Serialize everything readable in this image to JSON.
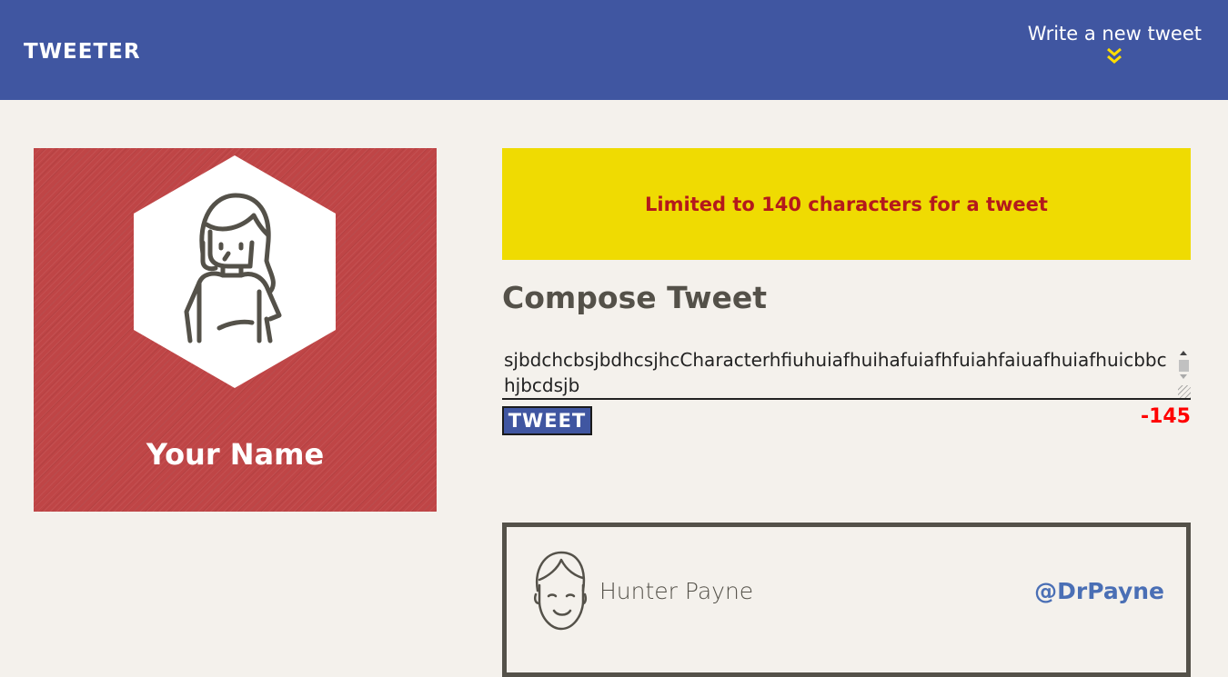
{
  "nav": {
    "brand": "TWEETER",
    "new_tweet_label": "Write a new tweet",
    "new_tweet_icon": "double-chevron-down-icon",
    "accent_color": "#4056a1",
    "chevron_color": "#ffdd00"
  },
  "profile": {
    "name": "Your Name",
    "avatar_icon": "woman-avatar-icon",
    "background_color": "#bf4546"
  },
  "error": {
    "message": "Limited to 140 characters for a tweet",
    "background_color": "#efdb02",
    "text_color": "#b4191c"
  },
  "compose": {
    "title": "Compose Tweet",
    "input_value": "sjbdchcbsjbdhcsjhcCharacterhfiuhuiafhuihafuiafhfuiahfaiuafhuiafhuicbbchjbcdsjb",
    "button_label": "TWEET",
    "counter": "-145"
  },
  "tweets": [
    {
      "author": "Hunter Payne",
      "handle": "@DrPayne",
      "avatar_icon": "man-avatar-icon"
    }
  ]
}
